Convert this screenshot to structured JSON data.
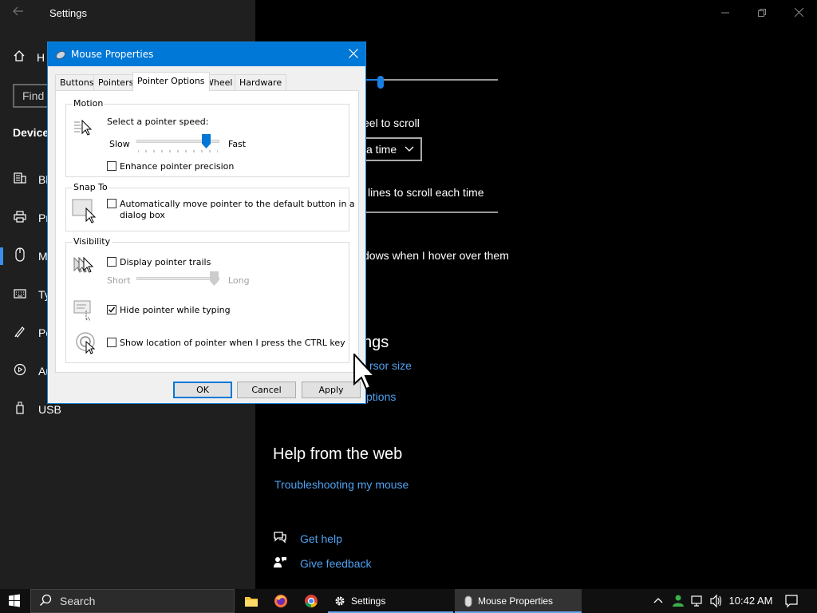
{
  "settings": {
    "title": "Settings",
    "sidebar": {
      "home_label": "H",
      "find_placeholder": "Find",
      "section_heading": "Device",
      "items": [
        {
          "icon": "bluetooth-icon",
          "label": "Bl"
        },
        {
          "icon": "printer-icon",
          "label": "Pr"
        },
        {
          "icon": "mouse-icon",
          "label": "M",
          "selected": true
        },
        {
          "icon": "keyboard-icon",
          "label": "Ty"
        },
        {
          "icon": "pen-icon",
          "label": "Pe"
        },
        {
          "icon": "autoplay-icon",
          "label": "Au"
        },
        {
          "icon": "usb-icon",
          "label": "USB"
        }
      ]
    },
    "content": {
      "wheel_scroll_label": "eel to scroll",
      "scroll_dropdown_value": "a time",
      "lines_label": "lines to scroll each time",
      "inactive_scroll_label": "dows when I hover over them",
      "related_heading": "ngs",
      "cursor_size_link": "rsor size",
      "mouse_options_link": "ptions",
      "help_heading": "Help from the web",
      "troubleshoot_link": "Troubleshooting my mouse",
      "get_help_link": "Get help",
      "feedback_link": "Give feedback"
    }
  },
  "dialog": {
    "title": "Mouse Properties",
    "tabs": [
      "Buttons",
      "Pointers",
      "Pointer Options",
      "Wheel",
      "Hardware"
    ],
    "active_tab": "Pointer Options",
    "motion": {
      "group_label": "Motion",
      "prompt": "Select a pointer speed:",
      "slow_label": "Slow",
      "fast_label": "Fast",
      "speed_level": 0.84,
      "enhance_label": "Enhance pointer precision",
      "enhance_checked": false
    },
    "snap_to": {
      "group_label": "Snap To",
      "auto_move_label_line1": "Automatically move pointer to the default button in a",
      "auto_move_label_line2": "dialog box",
      "checked": false
    },
    "visibility": {
      "group_label": "Visibility",
      "trails_label": "Display pointer trails",
      "trails_checked": false,
      "short_label": "Short",
      "long_label": "Long",
      "hide_typing_label": "Hide pointer while typing",
      "hide_typing_checked": true,
      "show_location_label": "Show location of pointer when I press the CTRL key",
      "show_location_checked": false
    },
    "buttons": {
      "ok": "OK",
      "cancel": "Cancel",
      "apply": "Apply"
    }
  },
  "taskbar": {
    "search_label": "Search",
    "apps": [
      {
        "icon": "file-explorer-icon",
        "label": ""
      },
      {
        "icon": "firefox-icon",
        "label": ""
      },
      {
        "icon": "chrome-icon",
        "label": ""
      },
      {
        "icon": "gear-icon",
        "label": "Settings"
      },
      {
        "icon": "mouse-icon",
        "label": "Mouse Properties"
      }
    ],
    "time": "10:42 AM"
  },
  "colors": {
    "accent": "#0078d7",
    "link": "#4ea1f1",
    "sidebar_bg": "#1f1f1f"
  }
}
